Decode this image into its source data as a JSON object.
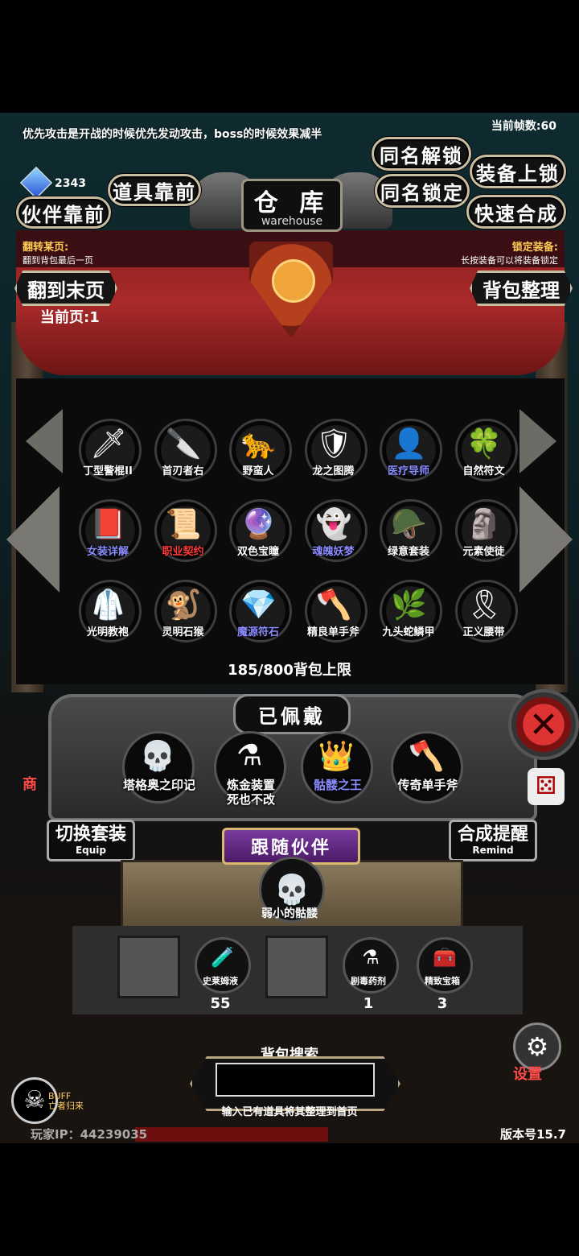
{
  "header": {
    "tip_text": "优先攻击是开战的时候优先发动攻击，boss的时候效果减半",
    "fps_label": "当前帧数:60",
    "gem_count": "2343"
  },
  "buttons": {
    "same_name_unlock": "同名解锁",
    "same_name_lock": "同名锁定",
    "equip_lock": "装备上锁",
    "quick_synth": "快速合成",
    "item_front": "道具靠前",
    "partner_front": "伙伴靠前",
    "goto_last_page": "翻到末页",
    "sort_bag": "背包整理"
  },
  "title": {
    "cn": "仓 库",
    "en": "warehouse"
  },
  "hints": {
    "flip_title": "翻转某页:",
    "flip_desc": "翻到背包最后一页",
    "lock_title": "锁定装备:",
    "lock_desc": "长按装备可以将装备锁定"
  },
  "current_page": "当前页:1",
  "inventory": [
    {
      "label": "丁型警棍II",
      "icon": "baton-icon",
      "color": "white",
      "glyph": "🗡"
    },
    {
      "label": "首刃者右",
      "icon": "blade-icon",
      "color": "white",
      "glyph": "🔪"
    },
    {
      "label": "野蛮人",
      "icon": "leopard-icon",
      "color": "white",
      "glyph": "🐆"
    },
    {
      "label": "龙之图腾",
      "icon": "dragon-totem-icon",
      "color": "white",
      "glyph": "🛡"
    },
    {
      "label": "医疗导师",
      "icon": "medic-icon",
      "color": "blue",
      "glyph": "👤"
    },
    {
      "label": "自然符文",
      "icon": "rune-icon",
      "color": "white",
      "glyph": "🍀"
    },
    {
      "label": "女装详解",
      "icon": "book-icon",
      "color": "blue",
      "glyph": "📕"
    },
    {
      "label": "职业契约",
      "icon": "scroll-icon",
      "color": "red",
      "glyph": "📜"
    },
    {
      "label": "双色宝瞳",
      "icon": "amulet-icon",
      "color": "white",
      "glyph": "🔮"
    },
    {
      "label": "魂魄妖梦",
      "icon": "spirit-icon",
      "color": "blue",
      "glyph": "👻"
    },
    {
      "label": "绿意套装",
      "icon": "armor-icon",
      "color": "white",
      "glyph": "🪖"
    },
    {
      "label": "元素使徒",
      "icon": "golem-icon",
      "color": "white",
      "glyph": "🗿"
    },
    {
      "label": "光明教袍",
      "icon": "robe-icon",
      "color": "white",
      "glyph": "🥼"
    },
    {
      "label": "灵明石猴",
      "icon": "monkey-icon",
      "color": "white",
      "glyph": "🐒"
    },
    {
      "label": "魔源符石",
      "icon": "crystal-icon",
      "color": "blue",
      "glyph": "💎"
    },
    {
      "label": "精良单手斧",
      "icon": "axe-icon",
      "color": "white",
      "glyph": "🪓"
    },
    {
      "label": "九头蛇鳞甲",
      "icon": "hydra-armor-icon",
      "color": "white",
      "glyph": "🌿"
    },
    {
      "label": "正义腰带",
      "icon": "belt-icon",
      "color": "white",
      "glyph": "🎗"
    }
  ],
  "capacity_text": "185/800背包上限",
  "equipped": {
    "title": "已佩戴",
    "items": [
      {
        "label": "塔格奥之印记",
        "icon": "skull-mark-icon",
        "color": "white",
        "glyph": "💀"
      },
      {
        "label": "炼金装置\n死也不改",
        "icon": "alchemy-icon",
        "color": "white",
        "glyph": "⚗"
      },
      {
        "label": "骷髅之王",
        "icon": "skeleton-king-icon",
        "color": "blue",
        "glyph": "👑"
      },
      {
        "label": "传奇单手斧",
        "icon": "legend-axe-icon",
        "color": "white",
        "glyph": "🪓"
      }
    ]
  },
  "switch_equip": {
    "cn": "切换套装",
    "en": "Equip"
  },
  "synth_remind": {
    "cn": "合成提醒",
    "en": "Remind"
  },
  "follow_partner": "跟随伙伴",
  "companion_label": "弱小的骷髅",
  "consumables": [
    {
      "label": "史莱姆液",
      "count": "55",
      "glyph": "🧪"
    },
    {
      "label": "剧毒药剂",
      "count": "1",
      "glyph": "⚗"
    },
    {
      "label": "精致宝箱",
      "count": "3",
      "glyph": "🧰"
    }
  ],
  "search": {
    "title": "背包搜索",
    "value": "",
    "hint": "输入已有道具将其整理到首页"
  },
  "footer": {
    "buff_label": "BUFF",
    "buff_name": "亡者归来",
    "player_id": "玩家IP：44239035",
    "version": "版本号15.7",
    "setting": "设置",
    "shop": "商"
  }
}
